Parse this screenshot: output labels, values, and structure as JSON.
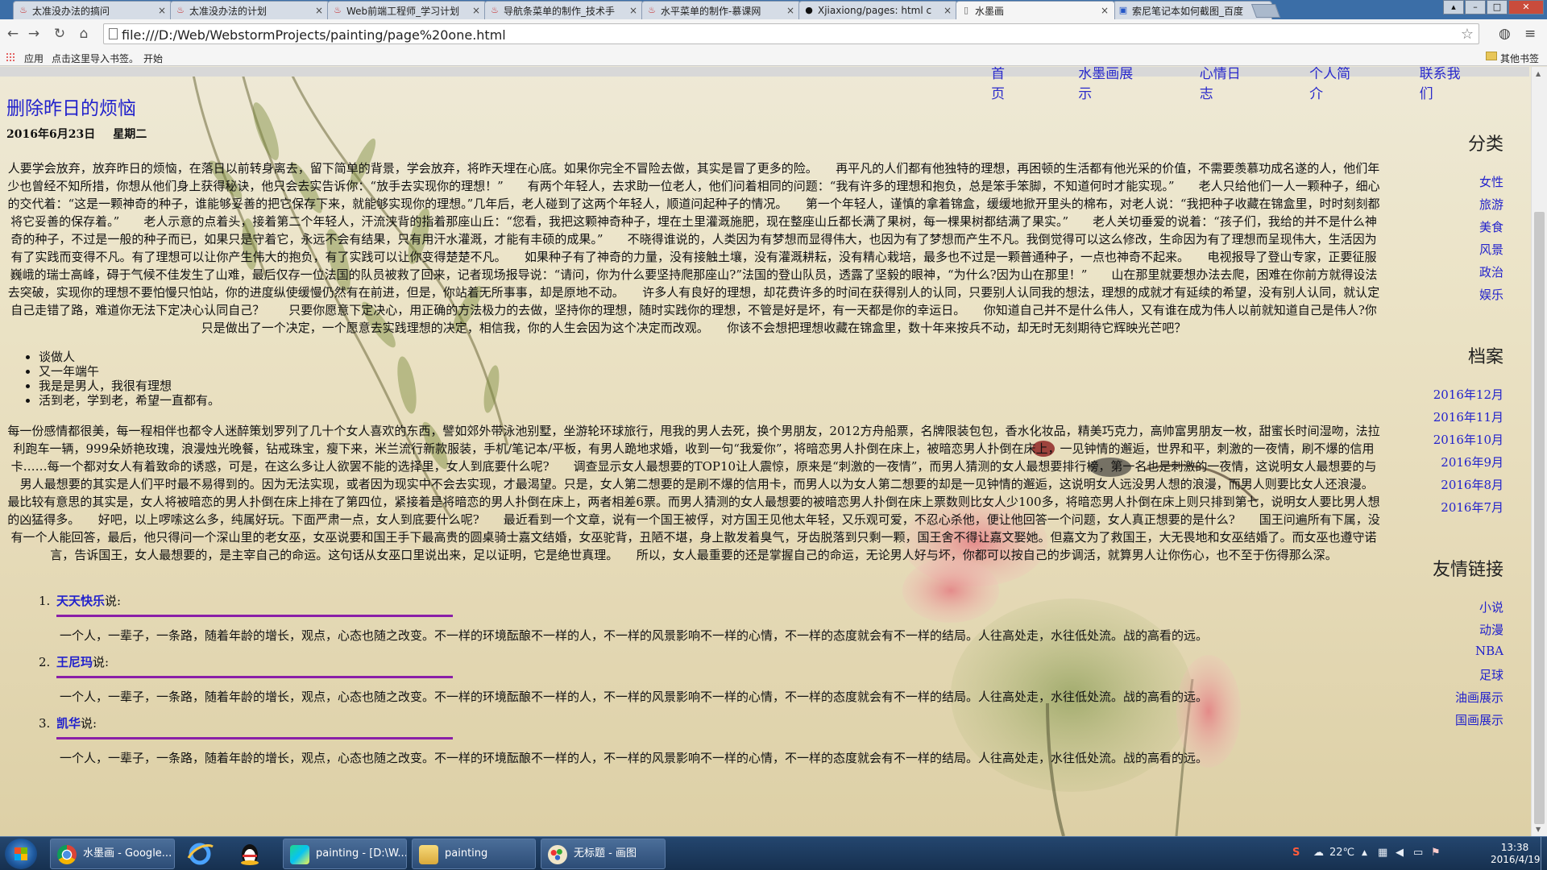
{
  "browser": {
    "tabs": [
      {
        "title": "太准没办法的搞问",
        "icon": "red-flame-icon",
        "active": false
      },
      {
        "title": "太准没办法的计划",
        "icon": "red-flame-icon",
        "active": false
      },
      {
        "title": "Web前端工程师_学习计划",
        "icon": "red-flame-icon",
        "active": false
      },
      {
        "title": "导航条菜单的制作_技术手",
        "icon": "red-flame-icon",
        "active": false
      },
      {
        "title": "水平菜单的制作-慕课网",
        "icon": "red-flame-icon",
        "active": false
      },
      {
        "title": "Xjiaxiong/pages: html c",
        "icon": "github-icon",
        "active": false
      },
      {
        "title": "水墨画",
        "icon": "page-icon",
        "active": true
      },
      {
        "title": "索尼笔记本如何截图_百度",
        "icon": "baidu-icon",
        "active": false
      }
    ],
    "tab_close": "×",
    "url": "file:///D:/Web/WebstormProjects/painting/page%20one.html",
    "bookmarks": {
      "apps": "应用",
      "import": "点击这里导入书签。",
      "start": "开始",
      "other": "其他书签"
    }
  },
  "page": {
    "topnav": [
      "首页",
      "水墨画展示",
      "心情日志",
      "个人简介",
      "联系我们"
    ],
    "title": "删除昨日的烦恼",
    "date": "2016年6月23日",
    "weekday": "星期二",
    "para1": "人要学会放弃，放弃昨日的烦恼，在落日以前转身离去，留下简单的背景，学会放弃，将昨天埋在心底。如果你完全不冒险去做，其实是冒了更多的险。　　再平凡的人们都有他独特的理想，再困顿的生活都有他光采的价值，不需要羡慕功成名遂的人，他们年少也曾经不知所措，你想从他们身上获得秘诀，他只会去实告诉你：“放手去实现你的理想！”　　有两个年轻人，去求助一位老人，他们问着相同的问题：“我有许多的理想和抱负，总是笨手笨脚，不知道何时才能实现。”　　老人只给他们一人一颗种子，细心的交代着：“这是一颗神奇的种子，谁能够妥善的把它保存下来，就能够实现你的理想。”几年后，老人碰到了这两个年轻人，顺道问起种子的情况。　　第一个年轻人，谨慎的拿着锦盒，缓缓地掀开里头的棉布，对老人说：“我把种子收藏在锦盒里，时时刻刻都将它妥善的保存着。”　　老人示意的点着头，接着第二个年轻人，汗流浃背的指着那座山丘：“您看，我把这颗神奇种子，埋在土里灌溉施肥，现在整座山丘都长满了果树，每一棵果树都结满了果实。”　　老人关切垂爱的说着：“孩子们，我给的并不是什么神奇的种子，不过是一般的种子而已，如果只是守着它，永远不会有结果，只有用汗水灌溉，才能有丰硕的成果。”　　不晓得谁说的，人类因为有梦想而显得伟大，也因为有了梦想而产生不凡。我倒觉得可以这么修改，生命因为有了理想而呈现伟大，生活因为有了实践而变得不凡。有了理想可以让你产生伟大的抱负，有了实践可以让你变得楚楚不凡。　　如果种子有了神奇的力量，没有接触土壤，没有灌溉耕耘，没有精心栽培，最多也不过是一颗普通种子，一点也神奇不起来。　　电视报导了登山专家，正要征服巍峨的瑞士高峰，碍于气候不佳发生了山难，最后仅存一位法国的队员被救了回来，记者现场报导说：“请问，你为什么要坚持爬那座山?”法国的登山队员，透露了坚毅的眼神，“为什么?因为山在那里！”　　山在那里就要想办法去爬，困难在你前方就得设法去突破，实现你的理想不要怕慢只怕站，你的进度纵使缓慢仍然有在前进，但是，你站着无所事事，却是原地不动。　　许多人有良好的理想，却花费许多的时间在获得别人的认同，只要别人认同我的想法，理想的成就才有延续的希望，没有别人认同，就认定自己走错了路，难道你无法下定决心认同自己？　　只要你愿意下定决心，用正确的方法极力的去做，坚持你的理想，随时实践你的理想，不管是好是坏，有一天都是你的幸运日。　　你知道自己并不是什么伟人，又有谁在成为伟人以前就知道自己是伟人?你只是做出了一个决定，一个愿意去实践理想的决定，相信我，你的人生会因为这个决定而改观。　　你该不会想把理想收藏在锦盒里，数十年来按兵不动，却无时无刻期待它辉映光芒吧？",
    "bullets": [
      "谈做人",
      "又一年端午",
      "我是是男人，我很有理想",
      "活到老，学到老，希望一直都有。"
    ],
    "para2": "每一份感情都很美，每一程相伴也都令人迷醉策划罗列了几十个女人喜欢的东西，譬如郊外带泳池别墅，坐游轮环球旅行，甩我的男人去死，换个男朋友，2012方舟船票，名牌限装包包，香水化妆品，精美巧克力，高帅富男朋友一枚，甜蜜长时间湿吻，法拉利跑车一辆，999朵娇艳玫瑰，浪漫烛光晚餐，钻戒珠宝，瘦下来，米兰流行新款服装，手机/笔记本/平板，有男人跪地求婚，收到一句“我爱你”，将暗恋男人扑倒在床上，被暗恋男人扑倒在床上，一见钟情的邂逅，世界和平，刺激的一夜情，刷不爆的信用卡……每一个都对女人有着致命的诱惑，可是，在这么多让人欲罢不能的选择里，女人到底要什么呢?　　调查显示女人最想要的TOP10让人震惊，原来是“刺激的一夜情”，而男人猜测的女人最想要排行榜，第一名也是刺激的一夜情，这说明女人最想要的与男人最想要的其实是人们平时最不易得到的。因为无法实现，或者因为现实中不会去实现，才最渴望。只是，女人第二想要的是刷不爆的信用卡，而男人以为女人第二想要的却是一见钟情的邂逅，这说明女人远没男人想的浪漫，而男人则要比女人还浪漫。　　最比较有意思的其实是，女人将被暗恋的男人扑倒在床上排在了第四位，紧接着是将暗恋的男人扑倒在床上，两者相差6票。而男人猜测的女人最想要的被暗恋男人扑倒在床上票数则比女人少100多，将暗恋男人扑倒在床上则只排到第七，说明女人要比男人想的凶猛得多。　　好吧，以上啰嗦这么多，纯属好玩。下面严肃一点，女人到底要什么呢?　　最近看到一个文章，说有一个国王被俘，对方国王见他太年轻，又乐观可爱，不忍心杀他，便让他回答一个问题，女人真正想要的是什么?　　国王问遍所有下属，没有一个人能回答，最后，他只得问一个深山里的老女巫，女巫说要和国王手下最高贵的圆桌骑士嘉文结婚，女巫驼背，丑陋不堪，身上散发着臭气，牙齿脱落到只剩一颗，国王舍不得让嘉文娶她。但嘉文为了救国王，大无畏地和女巫结婚了。而女巫也遵守诺言，告诉国王，女人最想要的，是主宰自己的命运。这句话从女巫口里说出来，足以证明，它是绝世真理。　　所以，女人最重要的还是掌握自己的命运，无论男人好与坏，你都可以按自己的步调活，就算男人让你伤心，也不至于伤得那么深。",
    "comments": [
      {
        "num": "1.",
        "name": "天天快乐",
        "suffix": "说:",
        "body": "一个人，一辈子，一条路，随着年龄的增长，观点，心态也随之改变。不一样的环境酝酿不一样的人，不一样的风景影响不一样的心情，不一样的态度就会有不一样的结局。人往高处走，水往低处流。战的高看的远。"
      },
      {
        "num": "2.",
        "name": "王尼玛",
        "suffix": "说:",
        "body": "一个人，一辈子，一条路，随着年龄的增长，观点，心态也随之改变。不一样的环境酝酿不一样的人，不一样的风景影响不一样的心情，不一样的态度就会有不一样的结局。人往高处走，水往低处流。战的高看的远。"
      },
      {
        "num": "3.",
        "name": "凯华",
        "suffix": "说:",
        "body": "一个人，一辈子，一条路，随着年龄的增长，观点，心态也随之改变。不一样的环境酝酿不一样的人，不一样的风景影响不一样的心情，不一样的态度就会有不一样的结局。人往高处走，水往低处流。战的高看的远。"
      }
    ],
    "sidebar": {
      "category_title": "分类",
      "categories": [
        "女性",
        "旅游",
        "美食",
        "风景",
        "政治",
        "娱乐"
      ],
      "archive_title": "档案",
      "archives": [
        "2016年12月",
        "2016年11月",
        "2016年10月",
        "2016年9月",
        "2016年8月",
        "2016年7月"
      ],
      "links_title": "友情链接",
      "links": [
        "小说",
        "动漫",
        "NBA",
        "足球",
        "油画展示",
        "国画展示"
      ]
    }
  },
  "taskbar": {
    "items": [
      {
        "label": "水墨画 - Google...",
        "icon": "chrome-icon"
      },
      {
        "label": "painting - [D:\\W...",
        "icon": "webstorm-icon"
      },
      {
        "label": "painting",
        "icon": "folder-icon"
      },
      {
        "label": "无标题 - 画图",
        "icon": "paint-icon"
      }
    ],
    "temperature": "22℃",
    "time": "13:38",
    "date": "2016/4/19"
  },
  "colors": {
    "link": "#2222cc",
    "divider": "#8a1fa8",
    "taskbar": "#1f3c62"
  }
}
